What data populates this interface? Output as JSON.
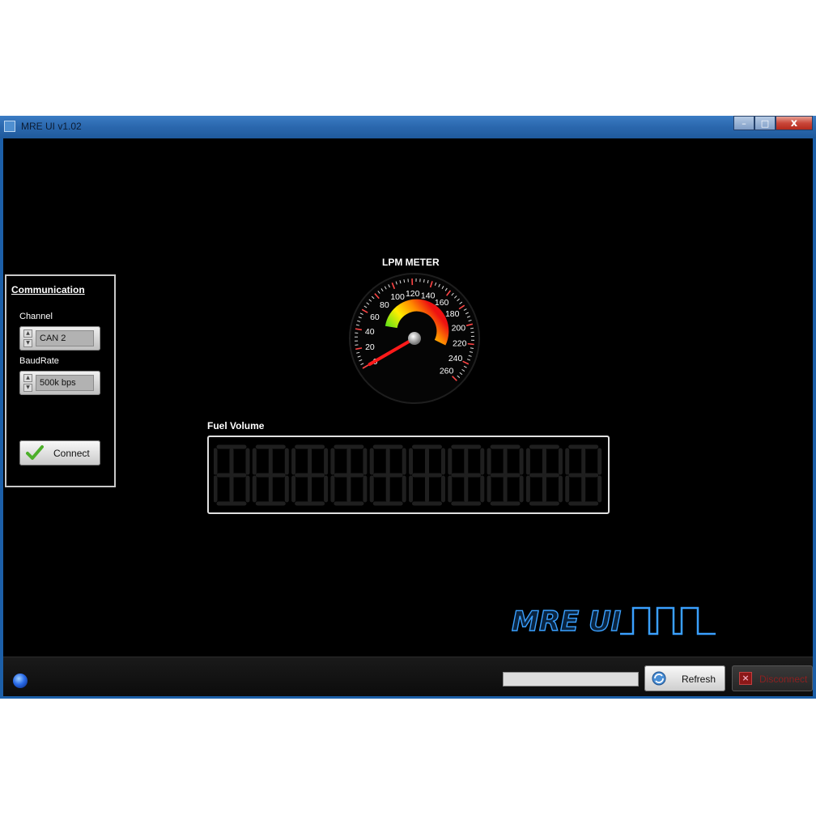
{
  "window": {
    "title": "MRE UI v1.02",
    "icon": "app-icon"
  },
  "window_buttons": {
    "minimize": "–",
    "maximize": "□",
    "close": "x"
  },
  "communication": {
    "title": "Communication",
    "channel_label": "Channel",
    "channel_value": "CAN 2",
    "baudrate_label": "BaudRate",
    "baudrate_value": "500k bps",
    "connect_label": "Connect"
  },
  "gauge": {
    "title": "LPM METER",
    "min": 0,
    "max": 260,
    "step": 20,
    "value": 0,
    "ticks": [
      "0",
      "20",
      "40",
      "60",
      "80",
      "100",
      "120",
      "140",
      "160",
      "180",
      "200",
      "220",
      "240",
      "260"
    ],
    "needle_color": "#ff1a1a"
  },
  "fuel_volume": {
    "title": "Fuel Volume",
    "digits": 10
  },
  "logo": {
    "text": "MRE UI"
  },
  "statusbar": {
    "progress": 0,
    "refresh_label": "Refresh",
    "disconnect_label": "Disconnect",
    "led_color": "#2a6be8"
  }
}
